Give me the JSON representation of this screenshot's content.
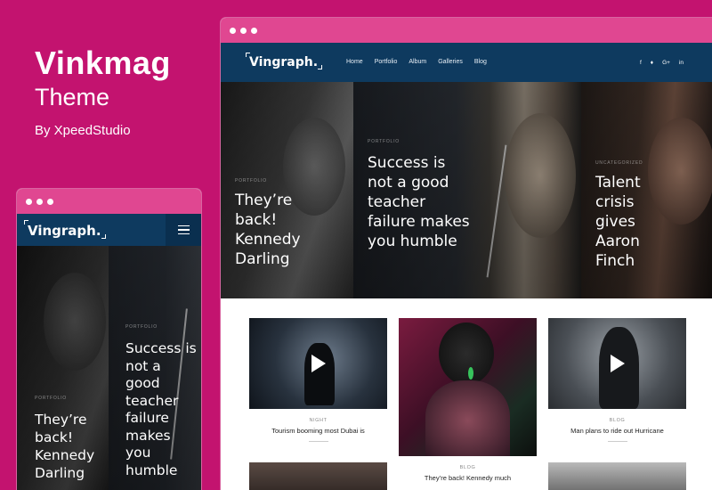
{
  "brand": {
    "title": "Vinkmag",
    "subtitle": "Theme",
    "author": "By XpeedStudio"
  },
  "site": {
    "logo": "Vingraph.",
    "nav": [
      "Home",
      "Portfolio",
      "Album",
      "Galleries",
      "Blog"
    ],
    "social": [
      "f",
      "♦",
      "G+",
      "in"
    ]
  },
  "hero": [
    {
      "category": "PORTFOLIO",
      "title": "They’re back! Kennedy Darling"
    },
    {
      "category": "PORTFOLIO",
      "title": "Success is not a good teacher failure makes you humble"
    },
    {
      "category": "UNCATEGORIZED",
      "title": "Talent crisis gives Aaron Finch"
    }
  ],
  "cards": [
    {
      "category": "NIGHT",
      "title": "Tourism booming most Dubai is"
    },
    {
      "category": "BLOG",
      "title": "They’re back! Kennedy much"
    },
    {
      "category": "BLOG",
      "title": "Man plans to ride out Hurricane"
    }
  ],
  "mobile": {
    "logo": "Vingraph.",
    "hero": [
      {
        "category": "PORTFOLIO",
        "title": "They’re back! Kennedy Darling"
      },
      {
        "category": "PORTFOLIO",
        "title": "Success is not a good teacher failure makes you humble"
      }
    ]
  }
}
